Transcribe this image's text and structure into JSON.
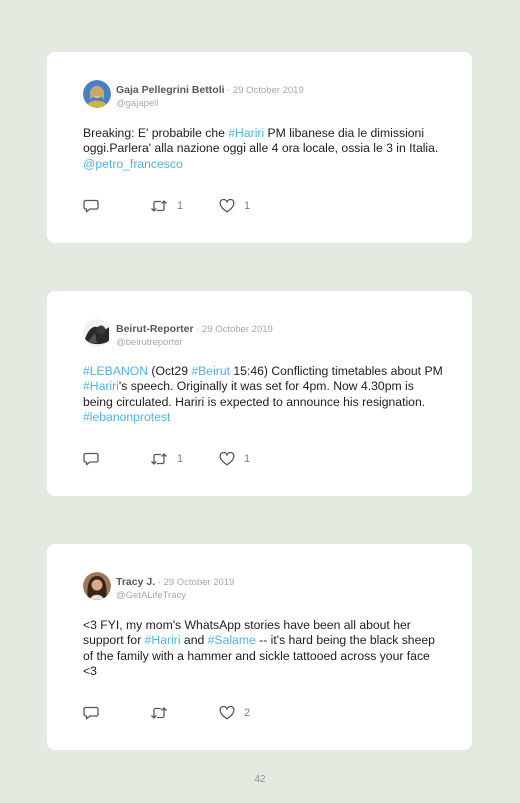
{
  "tweets": [
    {
      "name": "Gaja Pellegrini Bettoli",
      "date": " · 29 October 2019",
      "handle": "@gajapell",
      "text": [
        {
          "t": "Breaking: E' probabile che ",
          "link": false
        },
        {
          "t": "#Hariri",
          "link": true
        },
        {
          "t": " PM libanese dia le dimissioni oggi.Parlera' alla nazione oggi alle 4 ora locale, ossia le 3 in Italia. ",
          "link": false
        },
        {
          "t": "@petro_francesco",
          "link": true
        }
      ],
      "retweets": "1",
      "likes": "1",
      "avatar_icon": "user-avatar-photo"
    },
    {
      "name": "Beirut-Reporter",
      "date": " · 29 October 2019",
      "handle": "@beirutreporter",
      "text": [
        {
          "t": "#LEBANON",
          "link": true
        },
        {
          "t": " (Oct29 ",
          "link": false
        },
        {
          "t": "#Beirut",
          "link": true
        },
        {
          "t": " 15:46) Conflicting timetables about PM ",
          "link": false
        },
        {
          "t": "#Hariri",
          "link": true
        },
        {
          "t": "'s speech. Originally it was set for 4pm. Now 4.30pm is being circulated. Hariri is expected to announce his resignation. ",
          "link": false
        },
        {
          "t": "#lebanonprotest",
          "link": true
        }
      ],
      "retweets": "1",
      "likes": "1",
      "avatar_icon": "user-avatar-photo"
    },
    {
      "name": "Tracy J.",
      "date": " · 29 October 2019",
      "handle": "@GetALifeTracy",
      "text": [
        {
          "t": "<3 FYI, my mom's WhatsApp stories have been all about her support for ",
          "link": false
        },
        {
          "t": "#Hariri",
          "link": true
        },
        {
          "t": " and ",
          "link": false
        },
        {
          "t": "#Salame",
          "link": true
        },
        {
          "t": " -- it's hard being the black sheep of the family with a hammer and sickle tattooed across your face <3",
          "link": false
        }
      ],
      "retweets": "",
      "likes": "2",
      "avatar_icon": "user-avatar-photo"
    }
  ],
  "page_number": "42",
  "colors": {
    "background": "#e3ebe1",
    "card": "#ffffff",
    "link": "#4fb3e3",
    "meta": "#a4a8ad",
    "icon": "#55585c"
  },
  "icons": {
    "reply": "reply-icon",
    "retweet": "retweet-icon",
    "like": "heart-icon"
  }
}
